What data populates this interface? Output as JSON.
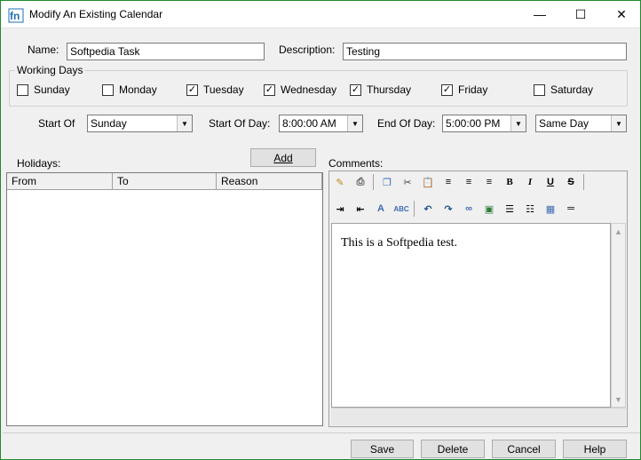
{
  "window": {
    "title": "Modify An Existing Calendar",
    "controls": {
      "minimize": "—",
      "maximize": "☐",
      "close": "✕"
    }
  },
  "form": {
    "name_label": "Name:",
    "name_value": "Softpedia Task",
    "description_label": "Description:",
    "description_value": "Testing",
    "working_days_label": "Working Days",
    "days": [
      {
        "label": "Sunday",
        "checked": false
      },
      {
        "label": "Monday",
        "checked": false
      },
      {
        "label": "Tuesday",
        "checked": true
      },
      {
        "label": "Wednesday",
        "checked": true
      },
      {
        "label": "Thursday",
        "checked": true
      },
      {
        "label": "Friday",
        "checked": true
      },
      {
        "label": "Saturday",
        "checked": false
      }
    ],
    "start_of_label": "Start Of",
    "start_of_value": "Sunday",
    "start_of_day_label": "Start Of Day:",
    "start_of_day_value": "8:00:00 AM",
    "end_of_day_label": "End Of Day:",
    "end_of_day_value": "5:00:00 PM",
    "end_day_option": "Same Day"
  },
  "holidays": {
    "label": "Holidays:",
    "add_label": "Add",
    "columns": [
      "From",
      "To",
      "Reason"
    ],
    "rows": []
  },
  "comments": {
    "label": "Comments:",
    "text": "This is a Softpedia test."
  },
  "buttons": {
    "save": "Save",
    "delete": "Delete",
    "cancel": "Cancel",
    "help": "Help"
  }
}
